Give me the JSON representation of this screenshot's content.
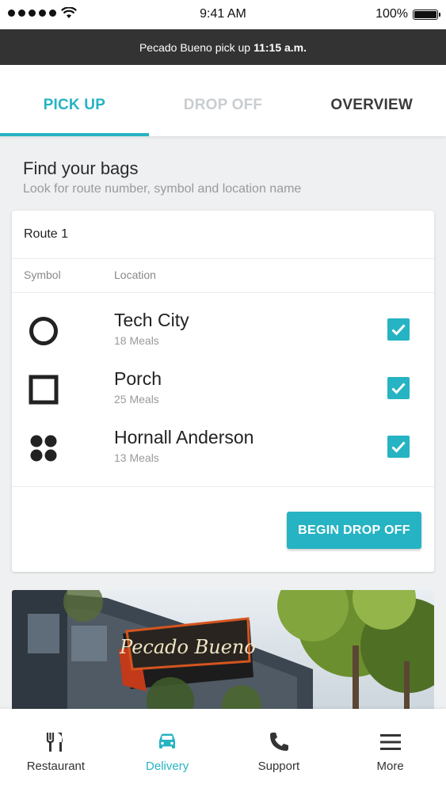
{
  "status_bar": {
    "time": "9:41 AM",
    "battery": "100%"
  },
  "banner": {
    "text": "Pecado Bueno pick up",
    "time": "11:15 a.m."
  },
  "tabs": [
    {
      "label": "PICK UP",
      "state": "active"
    },
    {
      "label": "DROP OFF",
      "state": "disabled"
    },
    {
      "label": "OVERVIEW",
      "state": "normal"
    }
  ],
  "section": {
    "title": "Find your bags",
    "subtitle": "Look for route number, symbol and location name"
  },
  "card": {
    "route": "Route 1",
    "col_symbol": "Symbol",
    "col_location": "Location",
    "rows": [
      {
        "symbol": "circle-icon",
        "name": "Tech City",
        "meals": "18 Meals",
        "checked": true
      },
      {
        "symbol": "square-icon",
        "name": "Porch",
        "meals": "25 Meals",
        "checked": true
      },
      {
        "symbol": "four-dots-icon",
        "name": "Hornall Anderson",
        "meals": "13 Meals",
        "checked": true
      }
    ],
    "button": "BEGIN DROP OFF"
  },
  "photo": {
    "sign_text": "Pecado Bueno"
  },
  "nav": [
    {
      "label": "Restaurant",
      "icon": "fork-knife-icon",
      "active": false
    },
    {
      "label": "Delivery",
      "icon": "car-icon",
      "active": true
    },
    {
      "label": "Support",
      "icon": "phone-icon",
      "active": false
    },
    {
      "label": "More",
      "icon": "menu-icon",
      "active": false
    }
  ],
  "colors": {
    "accent": "#26b3c3",
    "banner_bg": "#333333",
    "disabled": "#c9cdd0"
  }
}
